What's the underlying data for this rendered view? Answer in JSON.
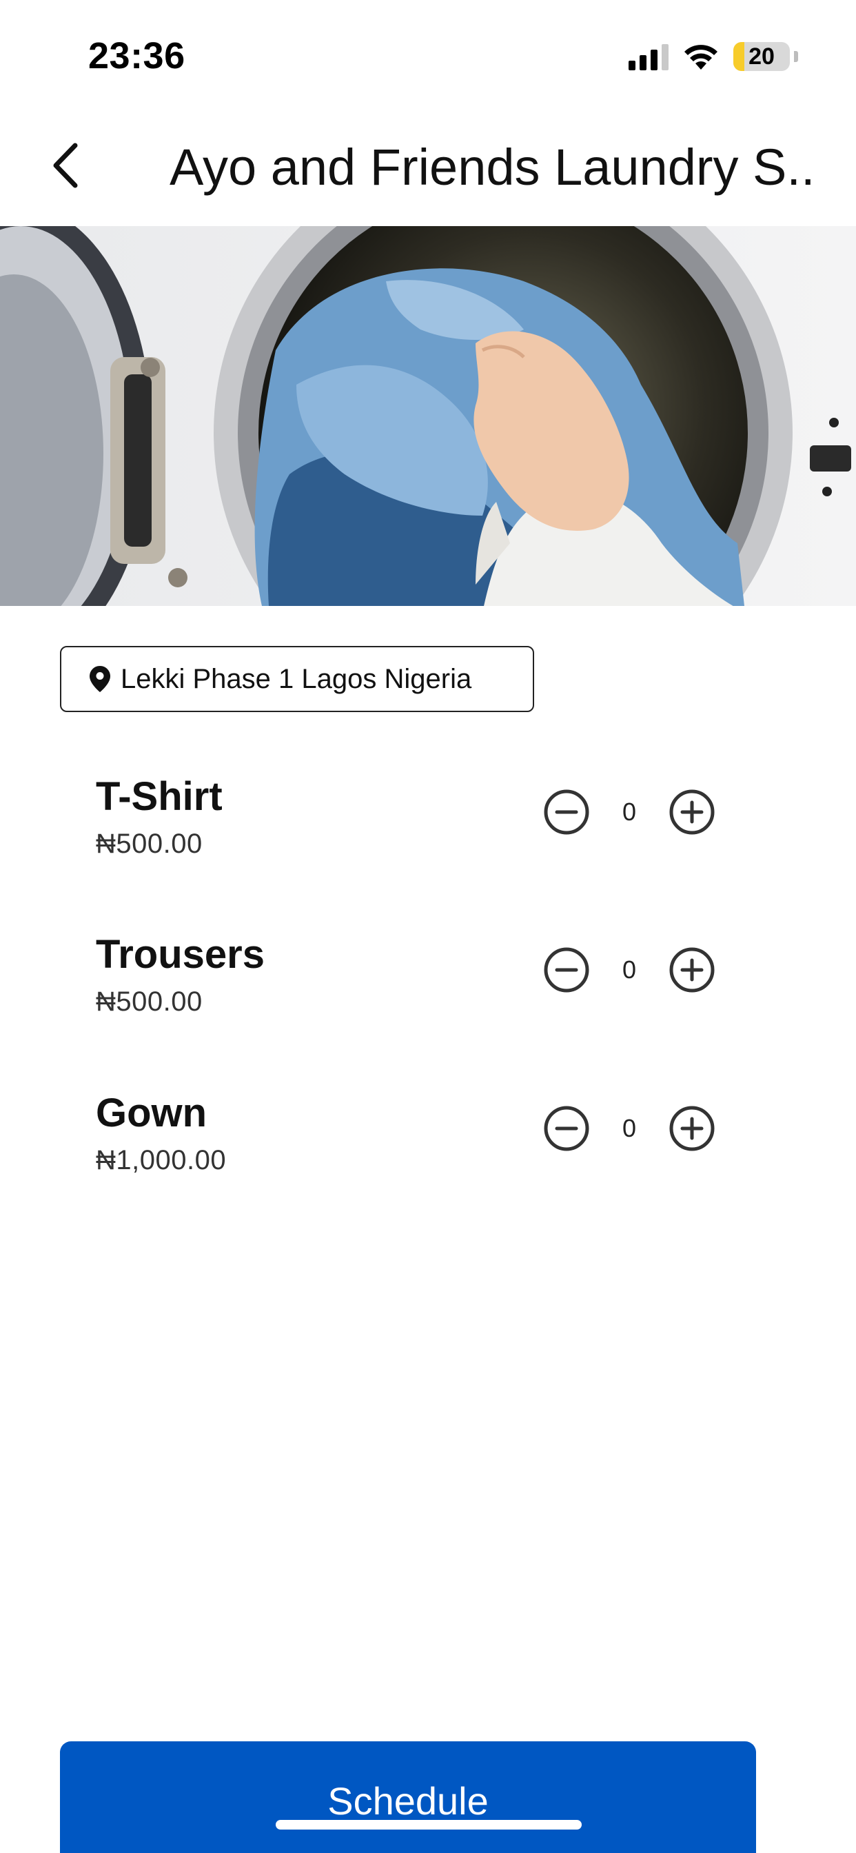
{
  "status_bar": {
    "time": "23:36",
    "battery_level": "20",
    "battery_fraction": 0.2,
    "icons": [
      "signal-icon",
      "wifi-icon",
      "battery-icon"
    ]
  },
  "header": {
    "title": "Ayo and Friends Laundry S...",
    "back_icon": "chevron-left-icon"
  },
  "hero": {
    "image": "washing-machine-with-jeans"
  },
  "location": {
    "icon": "map-pin-icon",
    "text": "Lekki Phase 1 Lagos Nigeria"
  },
  "items": [
    {
      "name": "T-Shirt",
      "price": "₦500.00",
      "quantity": "0"
    },
    {
      "name": "Trousers",
      "price": "₦500.00",
      "quantity": "0"
    },
    {
      "name": "Gown",
      "price": "₦1,000.00",
      "quantity": "0"
    }
  ],
  "actions": {
    "schedule_label": "Schedule",
    "accent_color": "#0057c2"
  }
}
